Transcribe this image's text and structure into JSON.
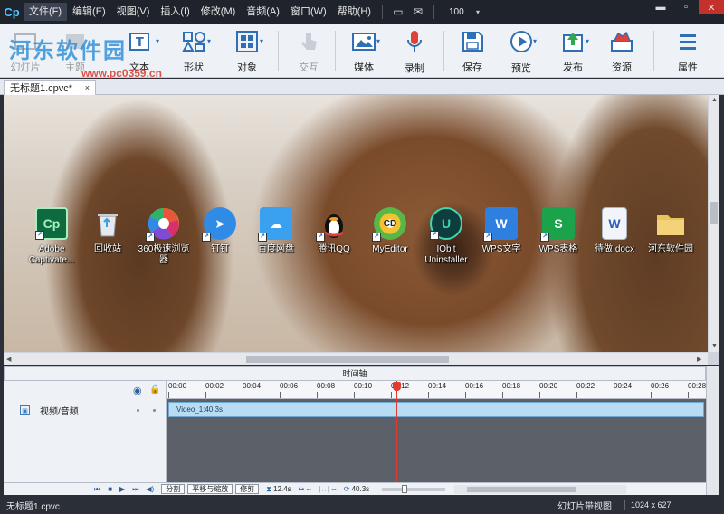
{
  "app": {
    "logo": "Cp"
  },
  "menubar": {
    "items": [
      "文件(F)",
      "编辑(E)",
      "视图(V)",
      "插入(I)",
      "修改(M)",
      "音频(A)",
      "窗口(W)",
      "帮助(H)"
    ],
    "zoom": "100",
    "icons": [
      "monitor-icon",
      "mail-icon"
    ]
  },
  "watermark": {
    "text": "河东软件园",
    "url": "www.pc0359.cn"
  },
  "toolbar": {
    "buttons": [
      {
        "label": "幻灯片",
        "icon": "slide-icon",
        "disabled": true
      },
      {
        "label": "主题",
        "icon": "theme-icon",
        "disabled": true
      },
      {
        "label": "文本",
        "icon": "text-icon",
        "disabled": false
      },
      {
        "label": "形状",
        "icon": "shapes-icon",
        "disabled": false
      },
      {
        "label": "对象",
        "icon": "object-icon",
        "disabled": false
      },
      {
        "label": "交互",
        "icon": "interaction-icon",
        "disabled": true
      },
      {
        "label": "媒体",
        "icon": "media-icon",
        "disabled": false
      },
      {
        "label": "录制",
        "icon": "record-icon",
        "disabled": false
      },
      {
        "label": "保存",
        "icon": "save-icon",
        "disabled": false
      },
      {
        "label": "预览",
        "icon": "preview-icon",
        "disabled": false
      },
      {
        "label": "发布",
        "icon": "publish-icon",
        "disabled": false
      },
      {
        "label": "资源",
        "icon": "assets-icon",
        "disabled": false
      },
      {
        "label": "属性",
        "icon": "properties-icon",
        "disabled": false
      }
    ]
  },
  "document_tab": {
    "title": "无标题1.cpvc*",
    "close": "×"
  },
  "desktop_icons": [
    {
      "label": "Adobe Captivate...",
      "glyph": "Cp",
      "color": "#0e6b3f"
    },
    {
      "label": "回收站",
      "glyph": "🗑",
      "color": "#d9dde3"
    },
    {
      "label": "360极速浏览器",
      "glyph": "●",
      "color": "#e8553a"
    },
    {
      "label": "钉钉",
      "glyph": "➤",
      "color": "#2f8be6"
    },
    {
      "label": "百度网盘",
      "glyph": "☁",
      "color": "#3aa0f0"
    },
    {
      "label": "腾讯QQ",
      "glyph": "◉",
      "color": "#222222"
    },
    {
      "label": "MyEditor",
      "glyph": "CD",
      "color": "#f2c230"
    },
    {
      "label": "IObit Uninstaller",
      "glyph": "U",
      "color": "#0d3d3d"
    },
    {
      "label": "WPS文字",
      "glyph": "W",
      "color": "#2f7fe0"
    },
    {
      "label": "WPS表格",
      "glyph": "S",
      "color": "#1aa34a"
    },
    {
      "label": "待做.docx",
      "glyph": "W",
      "color": "#f1f4f8"
    },
    {
      "label": "河东软件园",
      "glyph": "▰",
      "color": "#e9c25a"
    }
  ],
  "timeline": {
    "title": "时间轴",
    "track_label": "视频/音频",
    "clip": "Video_1:40.3s",
    "ruler": [
      "00:00",
      "00:02",
      "00:04",
      "00:06",
      "00:08",
      "00:10",
      "00:12",
      "00:14",
      "00:16",
      "00:18",
      "00:20",
      "00:22",
      "00:24",
      "00:26",
      "00:28"
    ],
    "buttons": [
      "分割",
      "平移与缩放",
      "修剪"
    ],
    "time1": "12.4s",
    "time2": "--",
    "time3": "--",
    "duration": "40.3s"
  },
  "status": {
    "file": "无标题1.cpvc",
    "view": "幻灯片带视图",
    "size": "1024 x 627"
  }
}
